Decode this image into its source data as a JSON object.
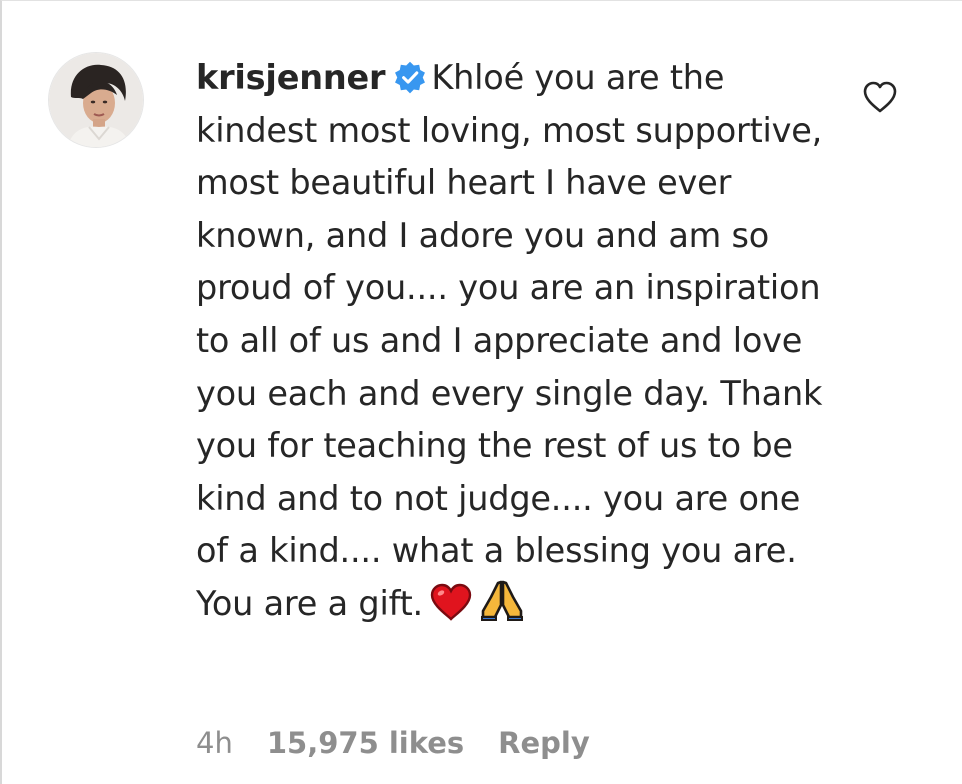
{
  "comment": {
    "username": "krisjenner",
    "verified_icon": "verified-badge-icon",
    "text": "Khloé you are the kindest most loving, most supportive, most beautiful heart I have ever known, and I adore you and am so proud of you.... you are an inspiration to all of us and I appreciate and love you each and every single day. Thank you for teaching the rest of us to be kind and to not judge.... you are one of a kind.... what a blessing you are. You are a gift.",
    "emojis": [
      "red-heart-emoji",
      "folded-hands-emoji"
    ],
    "like_icon": "heart-outline-icon"
  },
  "meta": {
    "time": "4h",
    "likes": "15,975 likes",
    "reply": "Reply"
  },
  "colors": {
    "text": "#262626",
    "muted": "#8e8e8e",
    "verified": "#3897f0",
    "heart": "#e0141e",
    "hands": "#f5b73b"
  }
}
